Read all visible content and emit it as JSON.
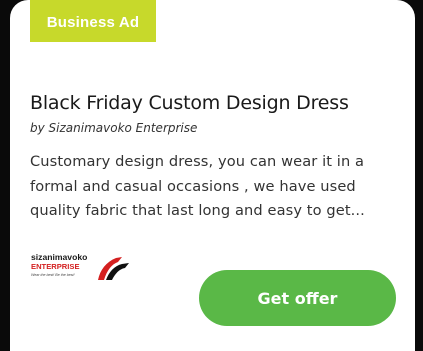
{
  "ad": {
    "badge": "Business Ad",
    "title": "Black Friday Custom Design Dress",
    "byline": "by Sizanimavoko Enterprise",
    "description_lines": [
      "Customary design dress, you can wear it in a",
      "formal and casual occasions , we have used",
      "quality fabric that last long and easy to get..."
    ],
    "cta_label": "Get offer",
    "logo": {
      "name_line": "sizanimavoko",
      "sub_line": "ENTERPRISE",
      "tagline": "Wear the best! Be the best!"
    }
  },
  "colors": {
    "badge": "#c7d92b",
    "cta": "#5ab847",
    "background": "#0a0a0a"
  }
}
